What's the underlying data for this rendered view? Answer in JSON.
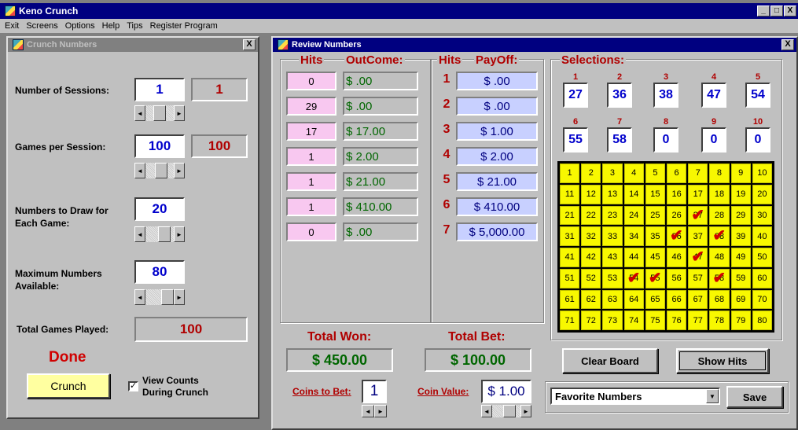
{
  "app": {
    "title": "Keno Crunch",
    "controls": [
      "_",
      "□",
      "X"
    ]
  },
  "menu": [
    "Exit",
    "Screens",
    "Options",
    "Help",
    "Tips",
    "Register Program"
  ],
  "crunch": {
    "title": "Crunch Numbers",
    "close": "X",
    "sessions": {
      "label": "Number of Sessions:",
      "value": "1",
      "display": "1"
    },
    "games": {
      "label": "Games per Session:",
      "value": "100",
      "display": "100"
    },
    "draw": {
      "label": "Numbers to Draw for Each Game:",
      "value": "20"
    },
    "max": {
      "label": "Maximum Numbers Available:",
      "value": "80"
    },
    "total": {
      "label": "Total Games Played:",
      "value": "100"
    },
    "status": "Done",
    "button": "Crunch",
    "checkbox": {
      "label": "View Counts During Crunch",
      "checked": true,
      "mark": "✓"
    }
  },
  "review": {
    "title": "Review Numbers",
    "close": "X",
    "hits_header": "Hits",
    "outcome_header": "OutCome:",
    "hits2_header": "Hits",
    "payoff_header": "PayOff:",
    "selections_header": "Selections:",
    "hits": [
      "0",
      "29",
      "17",
      "1",
      "1",
      "1",
      "0"
    ],
    "outcomes": [
      "$ .00",
      "$ .00",
      "$ 17.00",
      "$ 2.00",
      "$ 21.00",
      "$ 410.00",
      "$ .00"
    ],
    "payoff_hits": [
      "1",
      "2",
      "3",
      "4",
      "5",
      "6",
      "7"
    ],
    "payoffs": [
      "$ .00",
      "$ .00",
      "$ 1.00",
      "$ 2.00",
      "$ 21.00",
      "$ 410.00",
      "$ 5,000.00"
    ],
    "selections": [
      {
        "n": "1",
        "v": "27"
      },
      {
        "n": "2",
        "v": "36"
      },
      {
        "n": "3",
        "v": "38"
      },
      {
        "n": "4",
        "v": "47"
      },
      {
        "n": "5",
        "v": "54"
      },
      {
        "n": "6",
        "v": "55"
      },
      {
        "n": "7",
        "v": "58"
      },
      {
        "n": "8",
        "v": "0"
      },
      {
        "n": "9",
        "v": "0"
      },
      {
        "n": "10",
        "v": "0"
      }
    ],
    "board": [
      "1",
      "2",
      "3",
      "4",
      "5",
      "6",
      "7",
      "8",
      "9",
      "10",
      "11",
      "12",
      "13",
      "14",
      "15",
      "16",
      "17",
      "18",
      "19",
      "20",
      "21",
      "22",
      "23",
      "24",
      "25",
      "26",
      "27",
      "28",
      "29",
      "30",
      "31",
      "32",
      "33",
      "34",
      "35",
      "36",
      "37",
      "38",
      "39",
      "40",
      "41",
      "42",
      "43",
      "44",
      "45",
      "46",
      "47",
      "48",
      "49",
      "50",
      "51",
      "52",
      "53",
      "54",
      "55",
      "56",
      "57",
      "58",
      "59",
      "60",
      "61",
      "62",
      "63",
      "64",
      "65",
      "66",
      "67",
      "68",
      "69",
      "70",
      "71",
      "72",
      "73",
      "74",
      "75",
      "76",
      "77",
      "78",
      "79",
      "80"
    ],
    "checked": [
      27,
      36,
      38,
      47,
      54,
      55,
      58
    ],
    "check_mark": "✔",
    "total_won": {
      "label": "Total Won:",
      "value": "$ 450.00"
    },
    "total_bet": {
      "label": "Total Bet:",
      "value": "$ 100.00"
    },
    "coins": {
      "label": "Coins to Bet:",
      "value": "1"
    },
    "coin_value": {
      "label": "Coin Value:",
      "value": "$ 1.00"
    },
    "clear_button": "Clear Board",
    "show_button": "Show Hits",
    "favorites": {
      "selected": "Favorite Numbers"
    },
    "save_button": "Save"
  },
  "icons": {
    "left": "◄",
    "right": "►",
    "dropdown": "▼"
  }
}
